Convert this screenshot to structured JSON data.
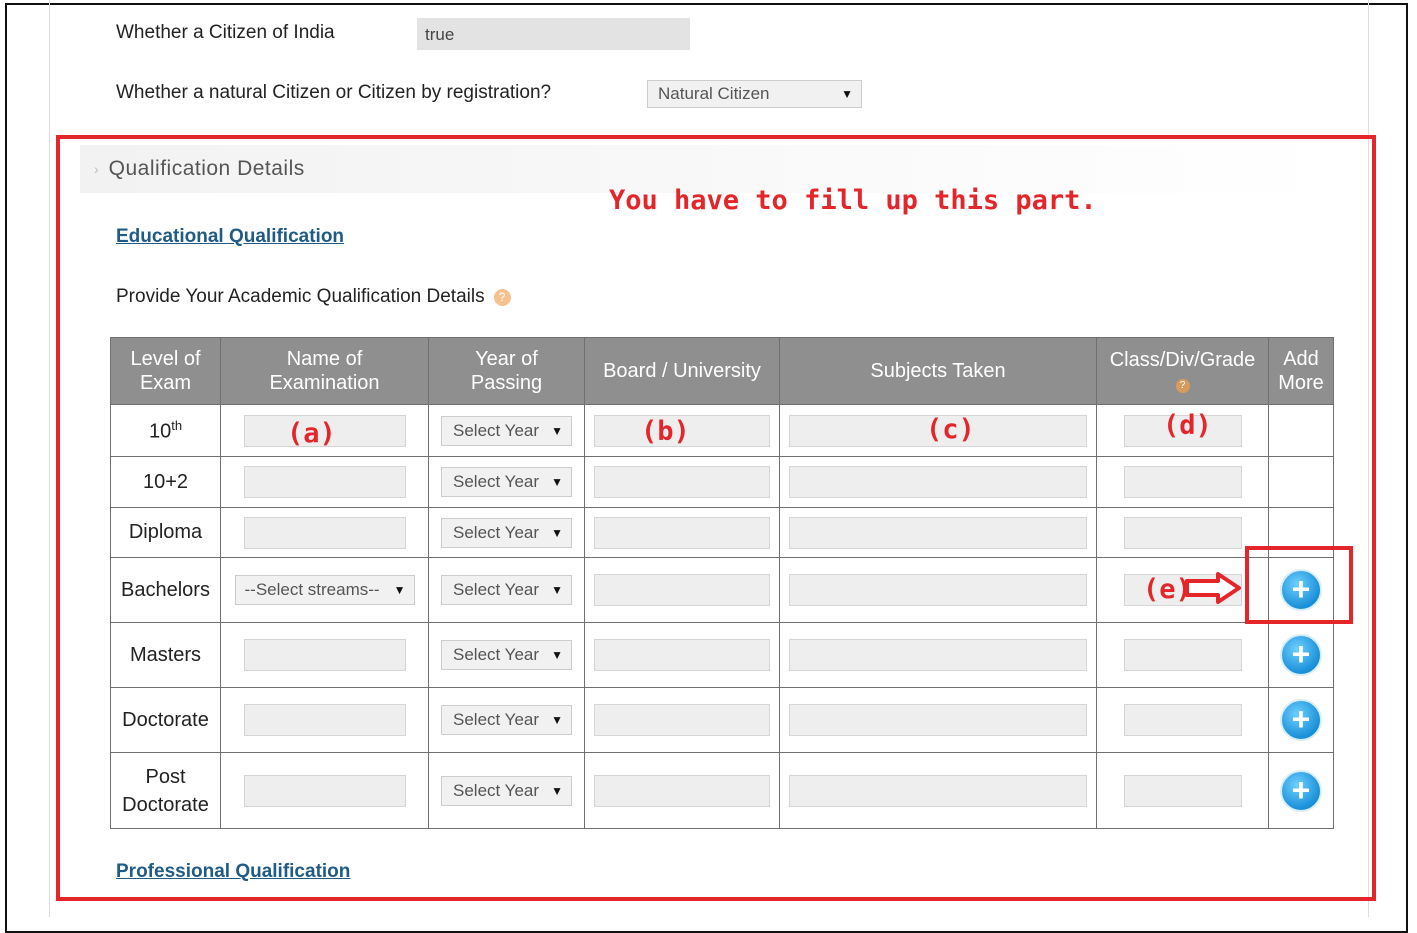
{
  "citizen": {
    "india_label": "Whether a Citizen of India",
    "india_value": "true",
    "type_label": "Whether a natural Citizen or Citizen by registration?",
    "type_value": "Natural Citizen"
  },
  "section": {
    "title": "Qualification Details",
    "note": "You have to fill up this part.",
    "edu_link": "Educational Qualification",
    "provide_label": "Provide Your Academic Qualification Details",
    "prof_link": "Professional Qualification"
  },
  "table": {
    "headers": {
      "level": [
        "Level of",
        "Exam"
      ],
      "name": [
        "Name of",
        "Examination"
      ],
      "year": [
        "Year of",
        "Passing"
      ],
      "board": "Board / University",
      "subjects": "Subjects Taken",
      "grade": "Class/Div/Grade",
      "add": [
        "Add",
        "More"
      ]
    },
    "rows": [
      {
        "level": "10",
        "level_sup": "th"
      },
      {
        "level": "10+2"
      },
      {
        "level": "Diploma"
      },
      {
        "level": "Bachelors",
        "stream": "--Select streams--"
      },
      {
        "level": "Masters"
      },
      {
        "level": "Doctorate"
      },
      {
        "level": "Post Doctorate"
      }
    ],
    "year_placeholder": "Select Year"
  },
  "annotations": {
    "a": "(a)",
    "b": "(b)",
    "c": "(c)",
    "d": "(d)",
    "e": "(e)"
  },
  "colors": {
    "accent_red": "#e4262b",
    "header_gray": "#8f8f8f",
    "link_blue": "#1f5b86",
    "plus_blue": "#1a8fd8"
  },
  "icons": {
    "add_more": "plus-circle-icon",
    "hint": "info-icon",
    "chevron": "chevron-right-icon",
    "dropdown": "caret-down-icon"
  }
}
